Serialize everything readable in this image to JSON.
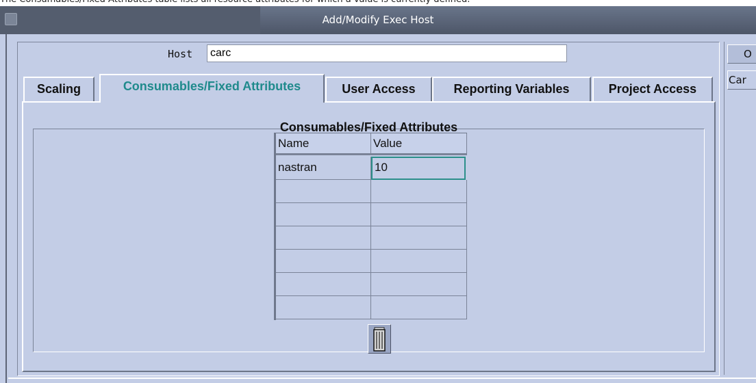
{
  "caption": "The Consumables/Fixed Attributes table lists all resource attributes for which a value is currently defined.",
  "window": {
    "title": "Add/Modify Exec Host"
  },
  "host": {
    "label": "Host",
    "value": "carc"
  },
  "tabs": [
    {
      "label": "Scaling"
    },
    {
      "label": "Consumables/Fixed Attributes"
    },
    {
      "label": "User Access"
    },
    {
      "label": "Reporting Variables"
    },
    {
      "label": "Project Access"
    }
  ],
  "active_tab": "Consumables/Fixed Attributes",
  "group": {
    "title": "Consumables/Fixed Attributes"
  },
  "table": {
    "columns": [
      "Name",
      "Value"
    ],
    "rows": [
      [
        "nastran",
        "10"
      ],
      [
        "",
        ""
      ],
      [
        "",
        ""
      ],
      [
        "",
        ""
      ],
      [
        "",
        ""
      ],
      [
        "",
        ""
      ],
      [
        "",
        ""
      ]
    ]
  },
  "side_buttons": {
    "ok": "O",
    "cancel": "Car"
  },
  "icons": {
    "delete": "trash-icon",
    "window_menu": "window-menu-icon"
  },
  "colors": {
    "active_tab": "#1f8a8c",
    "titlebar": "#5a6375",
    "dialog_bg": "#c3cde6",
    "selected_cell": "#2b8f8a"
  }
}
